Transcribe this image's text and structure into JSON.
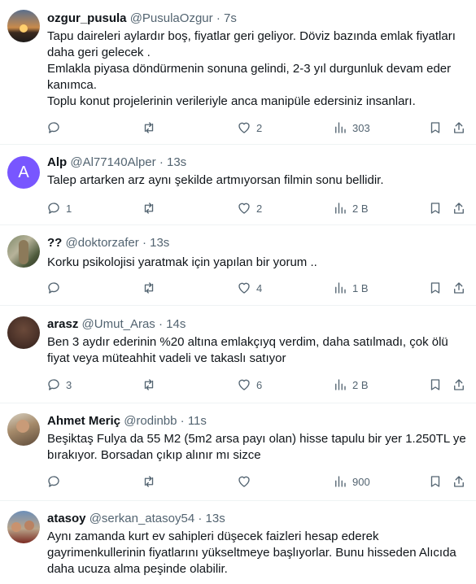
{
  "tweets": [
    {
      "name": "ozgur_pusula",
      "handle": "@PusulaOzgur",
      "time": "7s",
      "lines": [
        "Tapu daireleri aylardır boş, fiyatlar geri geliyor. Döviz bazında emlak fiyatları daha geri gelecek .",
        "Emlakla piyasa döndürmenin sonuna gelindi, 2-3 yıl durgunluk devam eder kanımca.",
        "Toplu konut projelerinin verileriyle anca manipüle edersiniz insanları."
      ],
      "replies": "",
      "retweets": "",
      "likes": "2",
      "views": "303"
    },
    {
      "name": "Alp",
      "handle": "@Al77140Alper",
      "time": "13s",
      "avatar_letter": "A",
      "lines": [
        "Talep artarken arz aynı şekilde artmıyorsan filmin sonu bellidir."
      ],
      "replies": "1",
      "retweets": "",
      "likes": "2",
      "views": "2 B"
    },
    {
      "name": "??",
      "handle": "@doktorzafer",
      "time": "13s",
      "lines": [
        "Korku psikolojisi yaratmak için yapılan bir yorum .."
      ],
      "replies": "",
      "retweets": "",
      "likes": "4",
      "views": "1 B"
    },
    {
      "name": "arasz",
      "handle": "@Umut_Aras",
      "time": "14s",
      "lines": [
        "Ben 3 aydır ederinin %20 altına emlakçıyq verdim, daha satılmadı, çok ölü fiyat veya müteahhit vadeli ve takaslı satıyor"
      ],
      "replies": "3",
      "retweets": "",
      "likes": "6",
      "views": "2 B"
    },
    {
      "name": "Ahmet Meriç",
      "handle": "@rodinbb",
      "time": "11s",
      "lines": [
        "Beşiktaş Fulya da 55 M2 (5m2 arsa payı olan) hisse tapulu bir yer 1.250TL ye bırakıyor. Borsadan çıkıp alınır mı sizce"
      ],
      "replies": "",
      "retweets": "",
      "likes": "",
      "views": "900"
    },
    {
      "name": "atasoy",
      "handle": "@serkan_atasoy54",
      "time": "13s",
      "lines": [
        "Aynı zamanda kurt ev sahipleri düşecek faizleri hesap ederek gayrimenkullerinin fiyatlarını yükseltmeye başlıyorlar. Bunu hisseden Alıcıda daha ucuza alma peşinde olabilir."
      ]
    }
  ],
  "separator": "·",
  "colors": {
    "text": "#0f1419",
    "secondary": "#536471",
    "divider": "#eff3f4",
    "avatar_alp": "#7856ff"
  }
}
